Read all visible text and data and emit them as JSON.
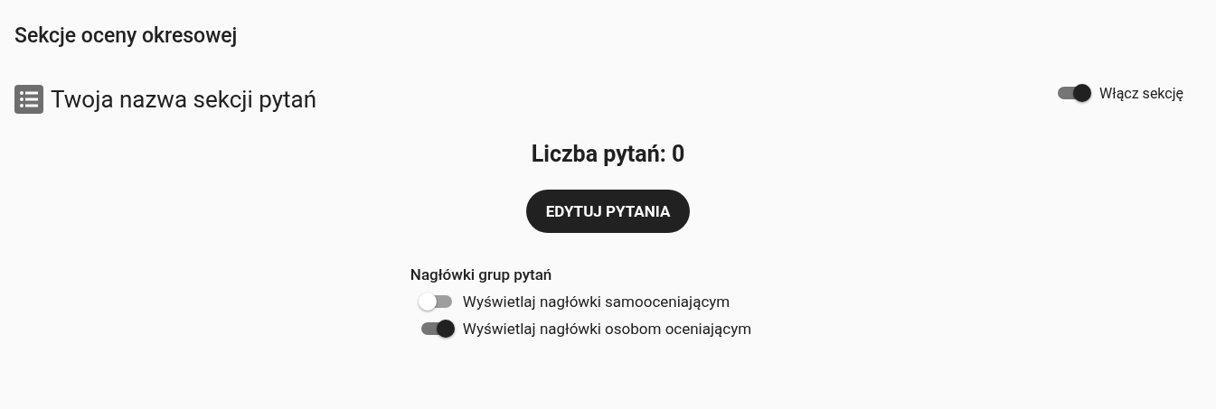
{
  "page_title": "Sekcje oceny okresowej",
  "section": {
    "title": "Twoja nazwa sekcji pytań",
    "enable_toggle": {
      "label": "Włącz sekcję",
      "on": true
    }
  },
  "question_count": "Liczba pytań: 0",
  "edit_button": "EDYTUJ PYTANIA",
  "group_headers": {
    "title": "Nagłówki grup pytań",
    "options": [
      {
        "label": "Wyświetlaj nagłówki samooceniającym",
        "on": false
      },
      {
        "label": "Wyświetlaj nagłówki osobom oceniającym",
        "on": true
      }
    ]
  }
}
